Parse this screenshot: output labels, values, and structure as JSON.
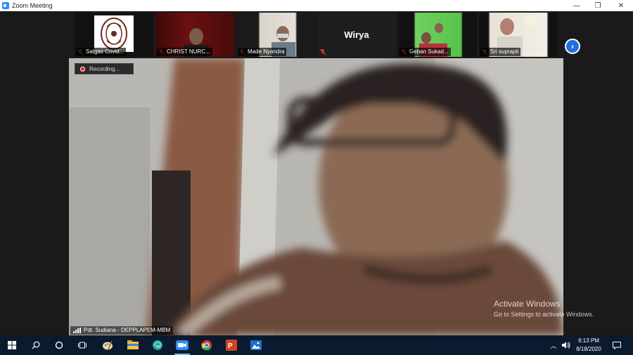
{
  "window": {
    "title": "Zoom Meeting"
  },
  "controls": {
    "minimize": "—",
    "restore": "❐",
    "close": "✕"
  },
  "gallery": [
    {
      "name": "Satgas Covid...",
      "muted": true
    },
    {
      "name": "CHRIST NURC...",
      "muted": true
    },
    {
      "name": "Made Nyandra",
      "muted": true
    },
    {
      "name": "",
      "display_name": "Wirya",
      "muted": true
    },
    {
      "name": "Geban Sukad...",
      "muted": true
    },
    {
      "name": "Sri suprapti",
      "muted": true
    }
  ],
  "recording": {
    "label": "Recording..."
  },
  "speaker": {
    "name": "Pdt. Sudiana - DEPPLAPEM-MBM"
  },
  "watermark": {
    "line1": "Activate Windows",
    "line2": "Go to Settings to activate Windows."
  },
  "clock": {
    "time": "6:13 PM",
    "date": "8/18/2020"
  },
  "colors": {
    "zoom_blue": "#2d8cff",
    "taskbar": "#0b1a2e",
    "rec_red": "#e02020"
  }
}
